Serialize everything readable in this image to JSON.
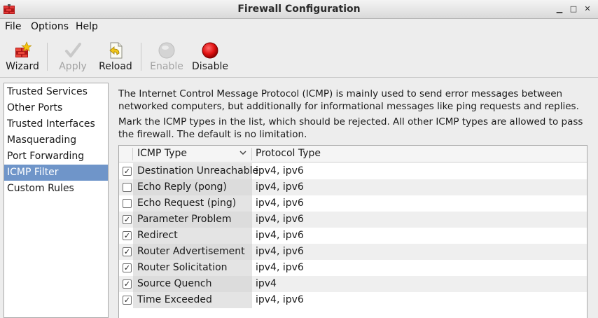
{
  "window": {
    "title": "Firewall Configuration"
  },
  "menu": [
    "File",
    "Options",
    "Help"
  ],
  "toolbar": {
    "wizard": "Wizard",
    "apply": "Apply",
    "reload": "Reload",
    "enable": "Enable",
    "disable": "Disable"
  },
  "sidebar": {
    "items": [
      {
        "label": "Trusted Services"
      },
      {
        "label": "Other Ports"
      },
      {
        "label": "Trusted Interfaces"
      },
      {
        "label": "Masquerading"
      },
      {
        "label": "Port Forwarding"
      },
      {
        "label": "ICMP Filter",
        "selected": true
      },
      {
        "label": "Custom Rules"
      }
    ]
  },
  "main": {
    "description_1": "The Internet Control Message Protocol (ICMP) is mainly used to send error messages between networked computers, but additionally for informational messages like ping requests and replies.",
    "description_2": "Mark the ICMP types in the list, which should be rejected. All other ICMP types are allowed to pass the firewall. The default is no limitation.",
    "table": {
      "headers": {
        "icmp_type": "ICMP Type",
        "protocol_type": "Protocol Type"
      },
      "rows": [
        {
          "checked": true,
          "name": "Destination Unreachable",
          "protocol": "ipv4, ipv6"
        },
        {
          "checked": false,
          "name": "Echo Reply (pong)",
          "protocol": "ipv4, ipv6"
        },
        {
          "checked": false,
          "name": "Echo Request (ping)",
          "protocol": "ipv4, ipv6"
        },
        {
          "checked": true,
          "name": "Parameter Problem",
          "protocol": "ipv4, ipv6"
        },
        {
          "checked": true,
          "name": "Redirect",
          "protocol": "ipv4, ipv6"
        },
        {
          "checked": true,
          "name": "Router Advertisement",
          "protocol": "ipv4, ipv6"
        },
        {
          "checked": true,
          "name": "Router Solicitation",
          "protocol": "ipv4, ipv6"
        },
        {
          "checked": true,
          "name": "Source Quench",
          "protocol": "ipv4"
        },
        {
          "checked": true,
          "name": "Time Exceeded",
          "protocol": "ipv4, ipv6"
        }
      ]
    }
  },
  "colors": {
    "selection": "#6f95c9",
    "disable_red": "#e01010"
  }
}
